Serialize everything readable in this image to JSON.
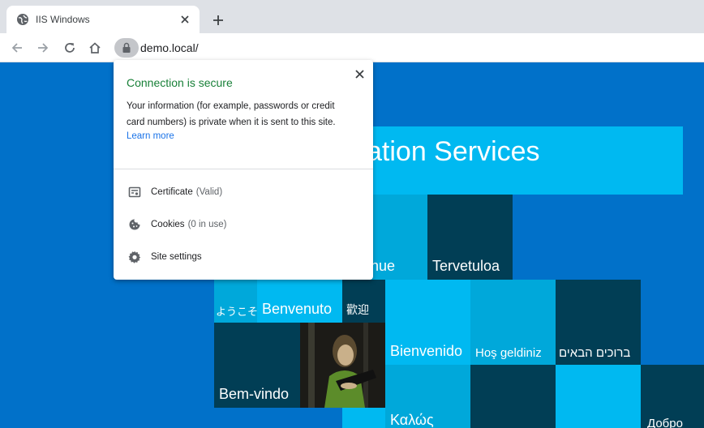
{
  "tab": {
    "title": "IIS Windows"
  },
  "address_bar": {
    "url": "demo.local/"
  },
  "page": {
    "banner_text": "ation Services",
    "tiles": [
      {
        "text": "nvenue"
      },
      {
        "text": "Tervetuloa"
      },
      {
        "text": "ようこそ"
      },
      {
        "text": "Benvenuto"
      },
      {
        "text": "歡迎"
      },
      {
        "text": "Bienvenido"
      },
      {
        "text": "Hoş geldiniz"
      },
      {
        "text": "ברוכים הבאים"
      },
      {
        "text": "Bem-vindo"
      },
      {
        "text": "Καλώς"
      },
      {
        "text": "Добро"
      }
    ]
  },
  "popup": {
    "title": "Connection is secure",
    "description": "Your information (for example, passwords or credit card numbers) is private when it is sent to this site.",
    "link": "Learn more",
    "rows": [
      {
        "label": "Certificate",
        "detail": "(Valid)",
        "icon": "certificate-icon"
      },
      {
        "label": "Cookies",
        "detail": "(0 in use)",
        "icon": "cookie-icon"
      },
      {
        "label": "Site settings",
        "detail": "",
        "icon": "gear-icon"
      }
    ]
  },
  "colors": {
    "page_bg": "#0171c9",
    "tile_light": "#00b9f1",
    "tile_mid": "#00a8da",
    "tile_dark": "#013e55",
    "secure_green": "#188038",
    "link_blue": "#1a73e8"
  }
}
